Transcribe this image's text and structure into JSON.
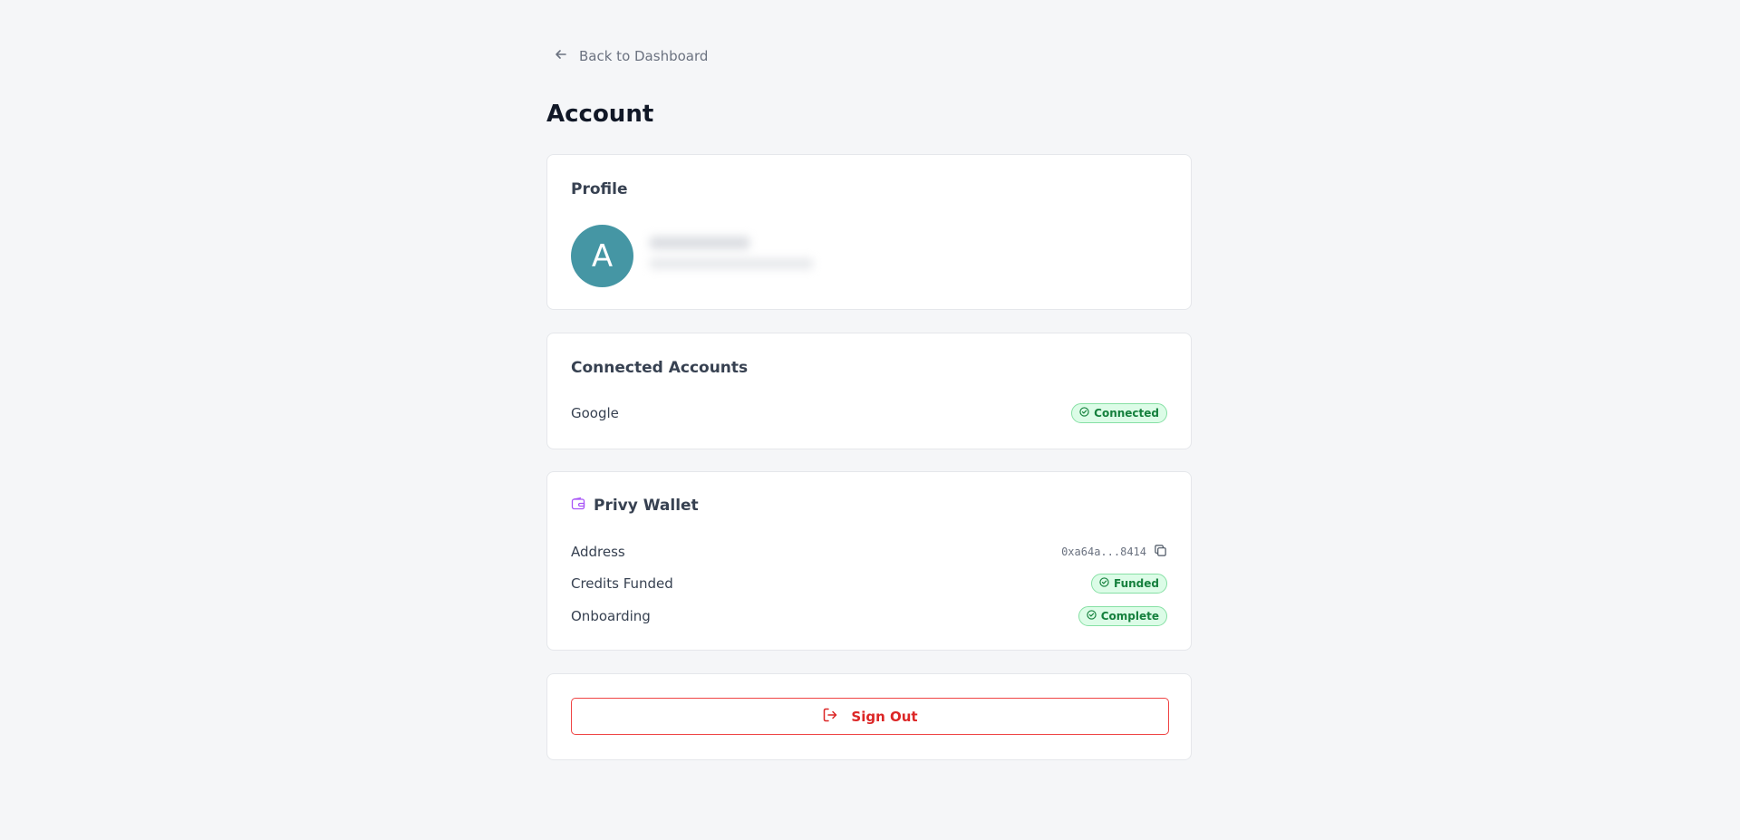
{
  "nav": {
    "back_label": "Back to Dashboard",
    "back_icon": "arrow-left-icon"
  },
  "page": {
    "title": "Account"
  },
  "profile": {
    "title": "Profile",
    "avatar_initial": "A",
    "avatar_color": "#4596a4",
    "details_blurred": true
  },
  "connected_accounts": {
    "title": "Connected Accounts",
    "items": [
      {
        "provider": "Google",
        "status": "Connected",
        "status_icon": "check-circle-icon"
      }
    ]
  },
  "wallet": {
    "title": "Privy Wallet",
    "title_icon": "wallet-icon",
    "accent_color": "#a855f7",
    "rows": [
      {
        "label": "Address",
        "value": "0xa64a...8414",
        "action_icon": "copy-icon"
      },
      {
        "label": "Credits Funded",
        "status": "Funded",
        "status_icon": "check-circle-icon"
      },
      {
        "label": "Onboarding",
        "status": "Complete",
        "status_icon": "check-circle-icon"
      }
    ]
  },
  "sign_out": {
    "label": "Sign Out",
    "icon": "log-out-icon",
    "color": "#dc2626"
  },
  "colors": {
    "background": "#f5f6f8",
    "badge_bg": "#dcfce7",
    "badge_text": "#15803d",
    "badge_border": "#86e0a4"
  }
}
